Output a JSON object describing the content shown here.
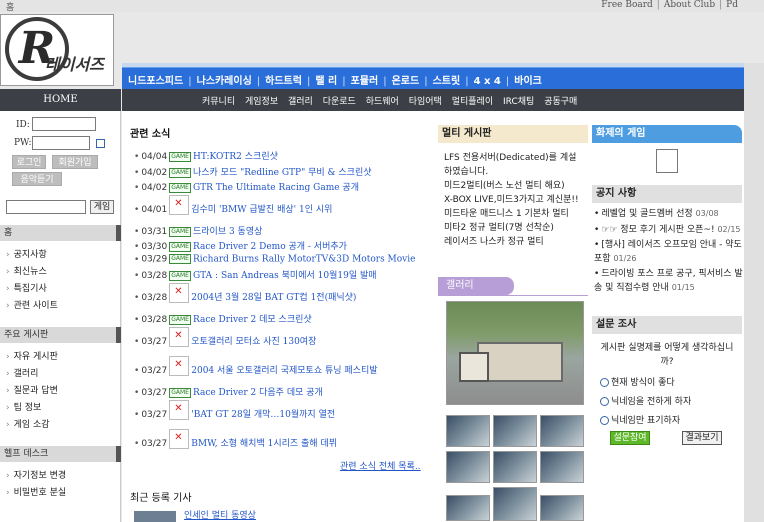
{
  "top": {
    "home": "홈",
    "links": [
      "Free Board",
      "About Club",
      "Pd"
    ]
  },
  "logo": {
    "letter": "R",
    "text": "레이서즈"
  },
  "nav1": [
    "니드포스피드",
    "나스카레이싱",
    "하드트럭",
    "랠 리",
    "포뮬러",
    "온로드",
    "스트릿",
    "4 x 4",
    "바이크"
  ],
  "nav2": [
    "커뮤니티",
    "게임정보",
    "갤러리",
    "다운로드",
    "하드웨어",
    "타임어택",
    "멀티플레이",
    "IRC채팅",
    "공동구매"
  ],
  "sidebar": {
    "home_label": "HOME",
    "id_label": "ID:",
    "pw_label": "PW:",
    "login_btn": "로그인",
    "join_btn": "회원가입",
    "music_btn": "음악듣기",
    "go_btn": "게임",
    "sec1": "홈",
    "menu1": [
      "공지사항",
      "최신뉴스",
      "특집기사",
      "관련 사이트"
    ],
    "sec2": "주요 게시판",
    "menu2": [
      "자유 게시판",
      "갤러리",
      "질문과 답변",
      "팁 정보",
      "게임 소감"
    ],
    "sec3": "헬프 데스크",
    "menu3": [
      "자기정보 변경",
      "비밀번호 분실"
    ]
  },
  "news": {
    "title": "관련 소식",
    "game_tag": "GAME",
    "items": [
      {
        "date": "04/04",
        "type": "tag",
        "text": "HT:KOTR2 스크린샷"
      },
      {
        "date": "04/02",
        "type": "tag",
        "text": "나스카 모드 \"Redline GTP\" 무비 & 스크린샷"
      },
      {
        "date": "04/02",
        "type": "tag",
        "text": "GTR The Ultimate Racing Game 공개"
      },
      {
        "date": "04/01",
        "type": "img",
        "text": "김수미 'BMW 급발진 배상' 1인 시위"
      },
      {
        "date": "03/31",
        "type": "tag",
        "text": "드라이브 3 동영상"
      },
      {
        "date": "03/30",
        "type": "tag",
        "text": "Race Driver 2 Demo 공개 - 서버추가"
      },
      {
        "date": "03/29",
        "type": "tag",
        "text": "Richard Burns Rally MotorTV&3D Motors Movie"
      },
      {
        "date": "03/28",
        "type": "tag",
        "text": "GTA : San Andreas 북미에서 10월19일 발매"
      },
      {
        "date": "03/28",
        "type": "img",
        "text": "2004년 3월 28일 BAT GT컵 1전(패닉샷)"
      },
      {
        "date": "03/28",
        "type": "tag",
        "text": "Race Driver 2 데모 스크린샷"
      },
      {
        "date": "03/27",
        "type": "img",
        "text": "오토갤러리 모터쇼 사진 130여장"
      },
      {
        "date": "03/27",
        "type": "img",
        "text": "2004 서울 오토갤러리 국제모토쇼 튜닝 페스티발"
      },
      {
        "date": "03/27",
        "type": "tag",
        "text": "Race Driver 2 다음주 데모 공개"
      },
      {
        "date": "03/27",
        "type": "img",
        "text": "'BAT GT 28일 개막…10월까지 열전"
      },
      {
        "date": "03/27",
        "type": "img",
        "text": "BMW, 소형 해치백 1시리즈 출해 데뷔"
      }
    ],
    "more": "관련 소식 전체 목록..",
    "recent_title": "최근 등록 기사",
    "recent_link": "인세인 멀티 동영상"
  },
  "multi": {
    "title": "멀티 게시판",
    "lines": [
      "LFS 전용서버(Dedicated)를 계설하였습니다.",
      "미드2멀티(버스 노선 멀티 해요)",
      "X-BOX LIVE,미드3가지고 계신분!!",
      "미드타운 매드니스 1 기본차 멀티",
      "미타2 정규 멀티(7명 선착순)",
      "레이서즈 나스카 정규 멀티"
    ]
  },
  "gallery": {
    "title": "갤러리"
  },
  "right": {
    "game_title": "화제의 게임",
    "notice_title": "공지 사항",
    "notices": [
      {
        "text": "레벨업 및 골드멤버 선정",
        "date": "03/08"
      },
      {
        "text": "☞☞ 정모 후기 게시판 오픈~!",
        "date": "02/15"
      },
      {
        "text": "[행사] 레이서즈 오프모임 안내 - 약도 포함",
        "date": "01/26"
      },
      {
        "text": "드라이빙 포스 프로 공구, 픽서비스 발송 및 직접수령 안내",
        "date": "01/15"
      }
    ],
    "poll_title": "설문 조사",
    "poll_q": "게시판 실명제를 어떻게 생각하십니까?",
    "options": [
      "현재 방식이 좋다",
      "닉네임을 전하게 하자",
      "닉네임만 표기하자"
    ],
    "vote_btn": "설문참여",
    "result_btn": "결과보기"
  },
  "colors": {
    "nav_blue": "#2a6ed9",
    "nav_dark": "#3c3f45",
    "link": "#2256c8",
    "gallery": "#b79ed6",
    "notice_blue": "#4d9de0"
  }
}
